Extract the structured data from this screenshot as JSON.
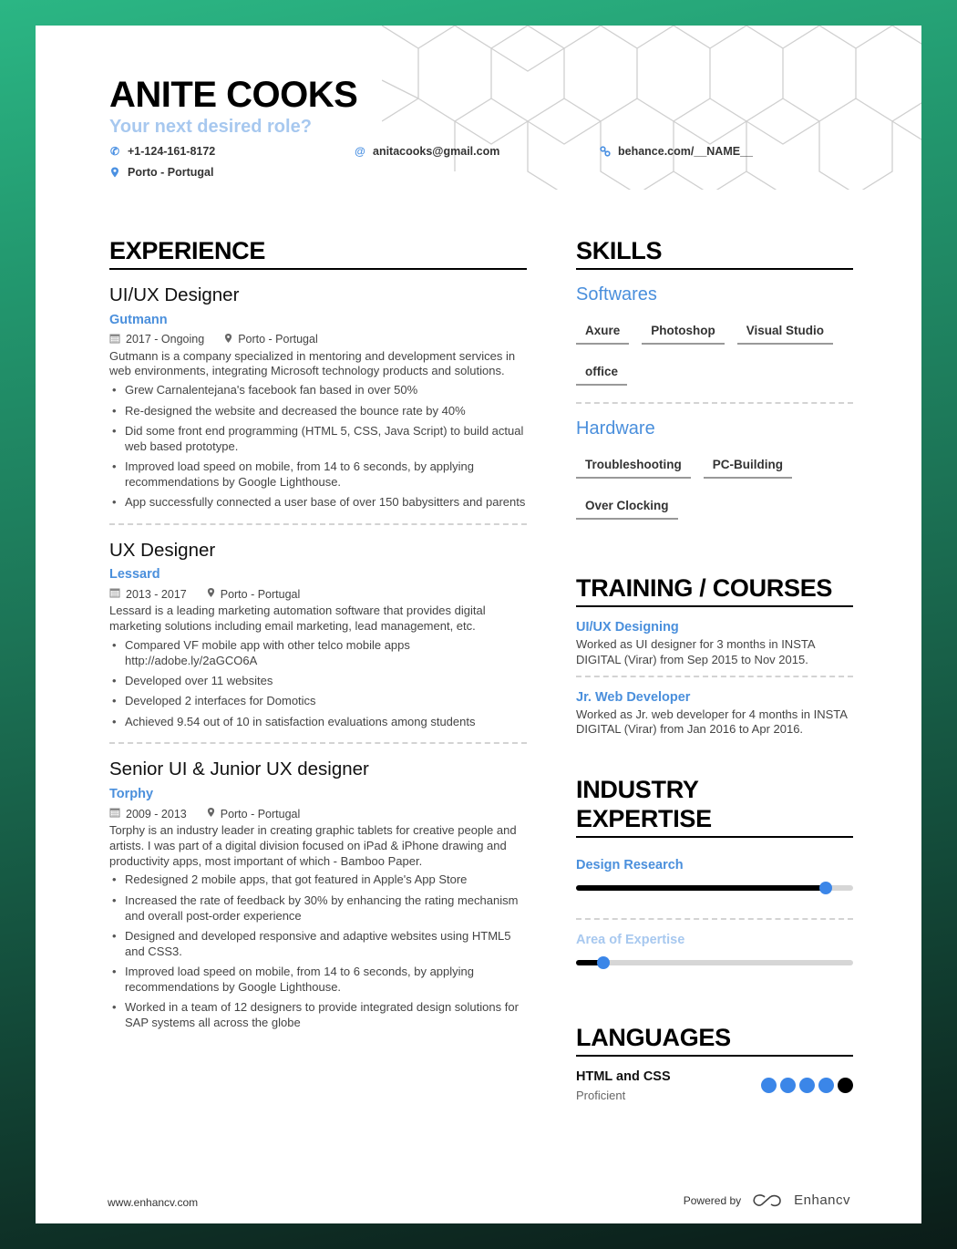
{
  "header": {
    "name": "ANITE COOKS",
    "role": "Your next desired role?",
    "phone": "+1-124-161-8172",
    "email": "anitacooks@gmail.com",
    "website": "behance.com/__NAME__",
    "location": "Porto - Portugal",
    "icons": {
      "phone": "phone-icon",
      "email": "at-icon",
      "website": "link-icon",
      "location": "location-pin-icon"
    }
  },
  "colors": {
    "accent": "#4a8fdc",
    "role": "#a7c8ef",
    "knob": "#3b86e8",
    "background_top": "#2bb684",
    "background_bottom": "#0b1c18"
  },
  "experience": {
    "title": "EXPERIENCE",
    "jobs": [
      {
        "title": "UI/UX Designer",
        "company": "Gutmann",
        "dates": "2017 - Ongoing",
        "location": "Porto - Portugal",
        "description": "Gutmann is a company specialized   in mentoring  and development services  in web environments,   integrating Microsoft technology products and  solutions.",
        "bullets": [
          "Grew Carnalentejana's facebook fan based in over 50%",
          "Re-designed the website and decreased the bounce rate by 40%",
          "Did some front end programming (HTML 5, CSS, Java Script) to build actual web based prototype.",
          "Improved load speed on mobile, from 14 to 6 seconds, by applying recommendations by Google Lighthouse.",
          "App successfully connected a user base of over 150 babysitters and parents"
        ]
      },
      {
        "title": "UX Designer",
        "company": "Lessard",
        "dates": "2013 - 2017",
        "location": "Porto - Portugal",
        "description": "Lessard is a leading marketing automation software that provides digital marketing solutions including email marketing, lead management, etc.",
        "bullets": [
          "Compared VF mobile app with other telco mobile apps http://adobe.ly/2aGCO6A",
          "Developed over 11 websites",
          "Developed 2 interfaces for Domotics",
          "Achieved 9.54 out of 10 in satisfaction evaluations among students"
        ]
      },
      {
        "title": "Senior UI & Junior UX designer",
        "company": "Torphy",
        "dates": "2009 - 2013",
        "location": "Porto - Portugal",
        "description": "Torphy is an industry leader in creating graphic tablets for creative people and artists. I was part of a digital division focused on iPad & iPhone drawing and productivity apps, most important of which - Bamboo Paper.",
        "bullets": [
          "Redesigned 2 mobile apps, that got featured in Apple's App Store",
          "Increased the rate of feedback by 30% by enhancing the rating mechanism and overall post-order experience",
          "Designed and developed responsive and adaptive websites using HTML5 and CSS3.",
          "Improved load speed on mobile, from 14 to 6 seconds, by applying recommendations by Google Lighthouse.",
          "Worked in a team of 12 designers to provide integrated design solutions for SAP systems all across the globe"
        ]
      }
    ]
  },
  "skills": {
    "title": "SKILLS",
    "groups": [
      {
        "name": "Softwares",
        "items": [
          "Axure",
          "Photoshop",
          "Visual Studio",
          "office"
        ]
      },
      {
        "name": "Hardware",
        "items": [
          "Troubleshooting",
          "PC-Building",
          "Over Clocking"
        ]
      }
    ]
  },
  "training": {
    "title": "TRAINING / COURSES",
    "items": [
      {
        "title": "UI/UX Designing",
        "description": "Worked as UI designer for 3 months in INSTA DIGITAL (Virar) from Sep 2015 to Nov 2015."
      },
      {
        "title": "Jr. Web Developer",
        "description": "Worked as Jr. web developer for 4 months in INSTA DIGITAL (Virar) from Jan 2016 to Apr 2016."
      }
    ]
  },
  "industry": {
    "title_line1": "INDUSTRY",
    "title_line2": "EXPERTISE",
    "items": [
      {
        "label": "Design Research",
        "level": 0.9,
        "label_color": "#4a8fdc"
      },
      {
        "label": "Area of Expertise",
        "level": 0.1,
        "label_color": "#a7c8ef"
      }
    ]
  },
  "languages": {
    "title": "LANGUAGES",
    "items": [
      {
        "name": "HTML and CSS",
        "level_text": "Proficient",
        "rating": 4,
        "max": 5
      }
    ]
  },
  "footer": {
    "website": "www.enhancv.com",
    "powered_by": "Powered by",
    "brand": "Enhancv"
  }
}
